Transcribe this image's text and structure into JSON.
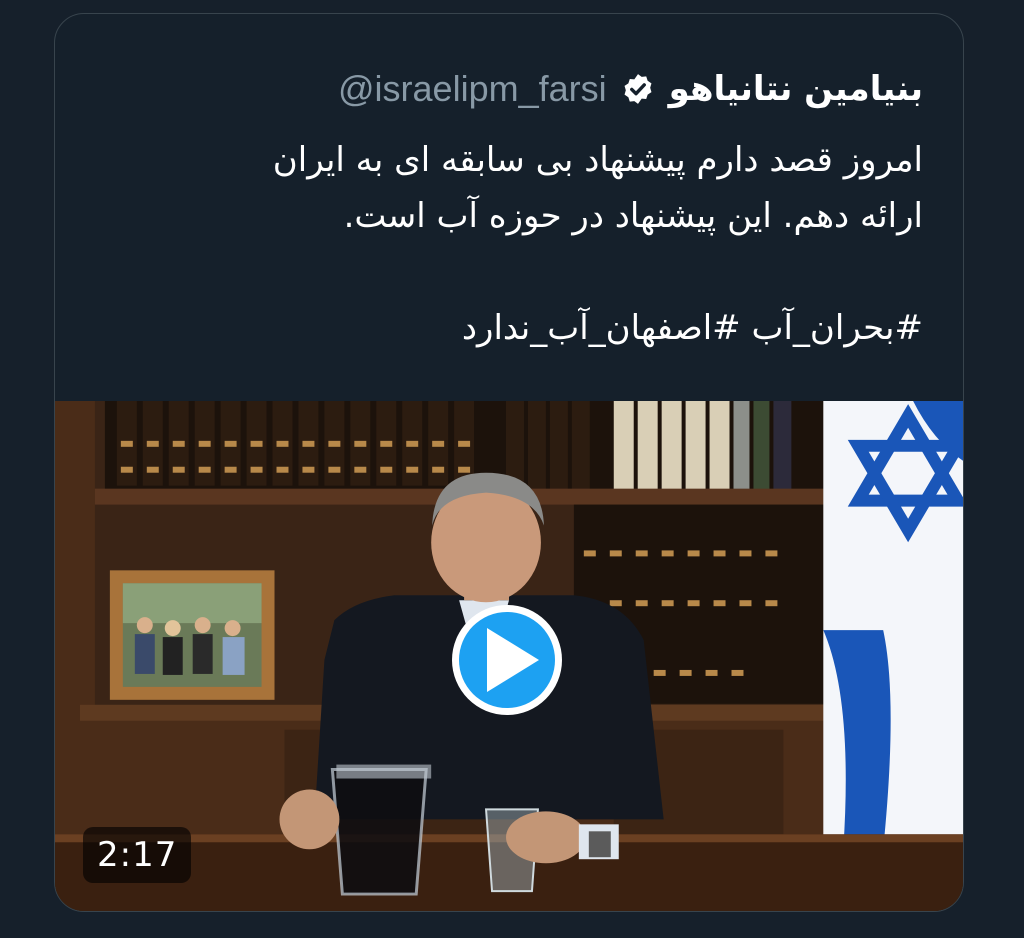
{
  "tweet": {
    "display_name": "بنیامین نتانیاهو",
    "handle": "@israelipm_farsi",
    "verified_icon": "verified-badge-icon",
    "text_line1": "امروز قصد دارم پیشنهاد بی سابقه ای به ایران",
    "text_line2": "ارائه دهم. این پیشنهاد در حوزه آب است.",
    "hashtags": "#بحران_آب #اصفهان_آب_ندارد"
  },
  "video": {
    "duration": "2:17",
    "play_icon": "play-icon",
    "accent": "#1da1f2"
  },
  "colors": {
    "background": "#15202b",
    "border": "#38444d",
    "handle": "#8899a6",
    "text": "#ffffff"
  }
}
